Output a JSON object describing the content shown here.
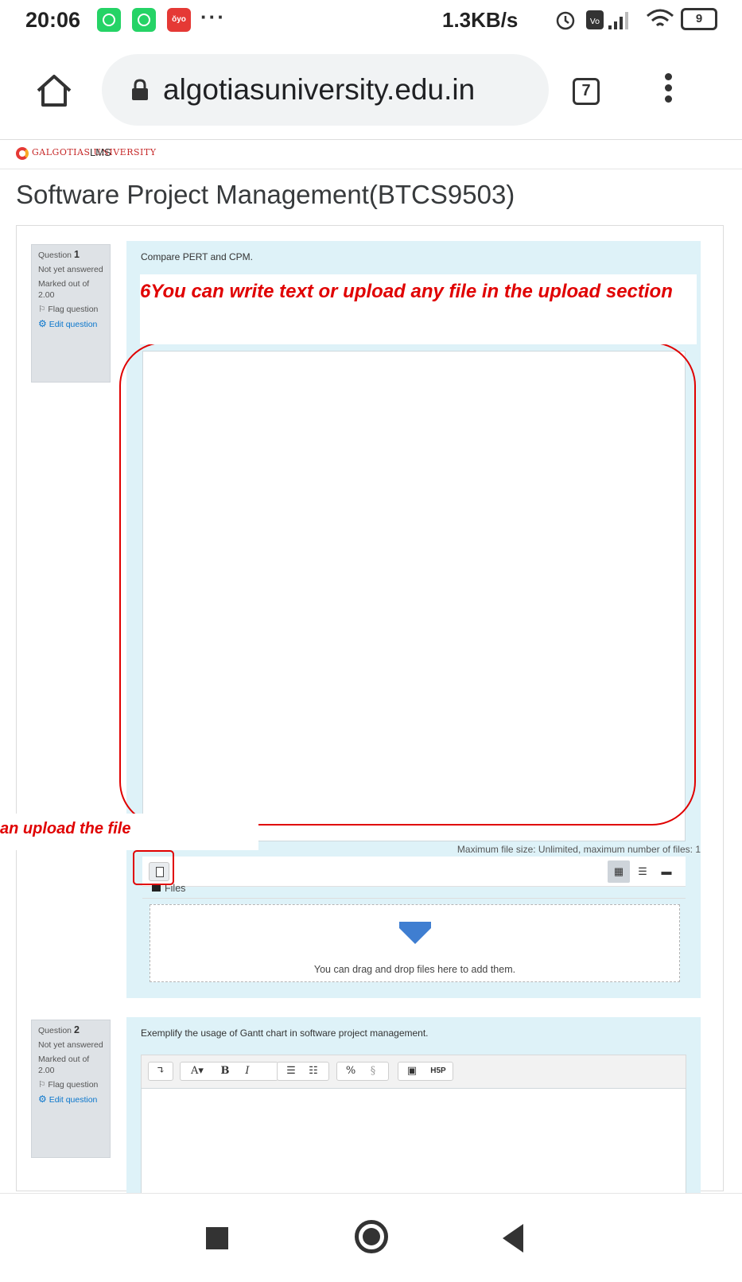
{
  "status_bar": {
    "time": "20:06",
    "network_speed": "1.3KB/s",
    "battery_level": "9",
    "oyo_label": "ŏyo"
  },
  "browser": {
    "url": "algotiasuniversity.edu.in",
    "tab_count": "7"
  },
  "site": {
    "logo_text": "GALGOTIAS UNIVERSITY",
    "logo_suffix": "LMS"
  },
  "page_title": "Software Project Management(BTCS9503)",
  "questions": [
    {
      "label": "Question",
      "number": "1",
      "state": "Not yet answered",
      "marks": "Marked out of 2.00",
      "flag": "Flag question",
      "edit": "Edit question",
      "text": "Compare PERT and CPM.",
      "max_file_note": "Maximum file size: Unlimited, maximum number of files: 1",
      "files_label": "Files",
      "drop_text": "You can drag and drop files here to add them."
    },
    {
      "label": "Question",
      "number": "2",
      "state": "Not yet answered",
      "marks": "Marked out of 2.00",
      "flag": "Flag question",
      "edit": "Edit question",
      "text": "Exemplify the usage of Gantt chart in software project management."
    }
  ],
  "annotations": {
    "write_text_callout": "6You can write text or upload any file in the upload section",
    "upload_callout": "an upload the file",
    "color": "#e00000"
  },
  "atto_toolbar": {
    "hsp_label": "H5P"
  },
  "colors": {
    "question_bg": "#def2f8",
    "info_bg": "#dee2e6",
    "link": "#0a76cc"
  }
}
